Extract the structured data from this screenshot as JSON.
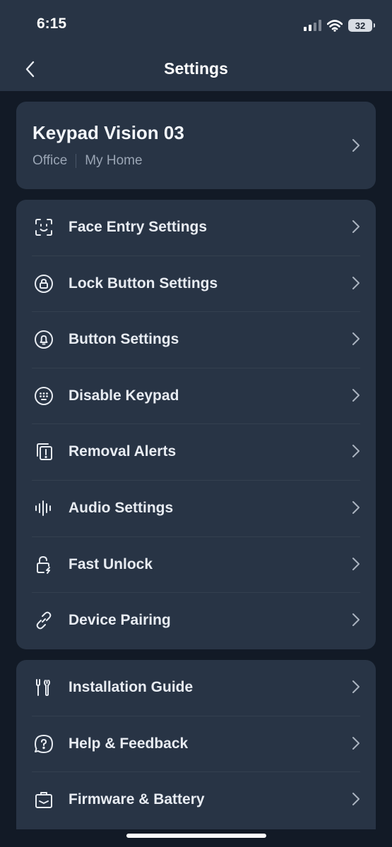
{
  "status_bar": {
    "time": "6:15",
    "battery_level": "32",
    "icons": [
      "signal-icon",
      "wifi-icon",
      "battery-icon"
    ]
  },
  "nav": {
    "title": "Settings",
    "back_icon": "chevron-left-icon"
  },
  "device": {
    "name": "Keypad Vision 03",
    "room": "Office",
    "home": "My Home"
  },
  "settings_items": [
    {
      "label": "Face Entry Settings",
      "icon": "face-scan-icon"
    },
    {
      "label": "Lock Button Settings",
      "icon": "lock-button-icon"
    },
    {
      "label": "Button Settings",
      "icon": "bell-button-icon"
    },
    {
      "label": "Disable Keypad",
      "icon": "keypad-icon"
    },
    {
      "label": "Removal Alerts",
      "icon": "removal-alert-icon"
    },
    {
      "label": "Audio Settings",
      "icon": "audio-waveform-icon"
    },
    {
      "label": "Fast Unlock",
      "icon": "fast-unlock-icon"
    },
    {
      "label": "Device Pairing",
      "icon": "link-icon"
    }
  ],
  "support_items": [
    {
      "label": "Installation Guide",
      "icon": "tools-icon"
    },
    {
      "label": "Help & Feedback",
      "icon": "help-chat-icon"
    },
    {
      "label": "Firmware & Battery",
      "icon": "firmware-icon"
    }
  ],
  "colors": {
    "background": "#121a26",
    "card": "#283445",
    "text": "#e8ecf2",
    "secondary_text": "#9aa5b4"
  }
}
